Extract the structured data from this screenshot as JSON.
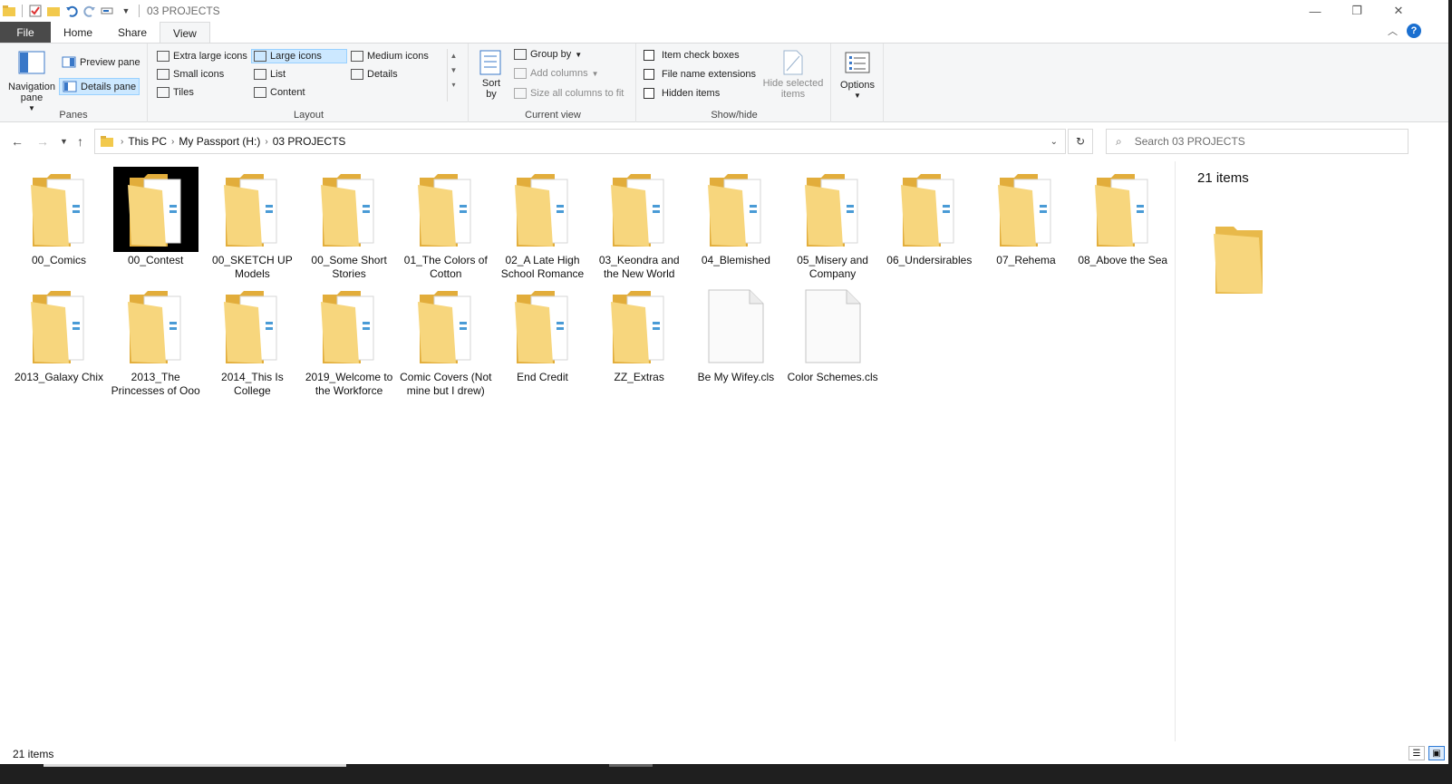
{
  "window": {
    "title": "03 PROJECTS"
  },
  "tabs": {
    "file": "File",
    "home": "Home",
    "share": "Share",
    "view": "View"
  },
  "ribbon": {
    "panes": {
      "navigation_pane": "Navigation pane",
      "preview_pane": "Preview pane",
      "details_pane": "Details pane",
      "group_label": "Panes"
    },
    "layout": {
      "extra_large_icons": "Extra large icons",
      "large_icons": "Large icons",
      "medium_icons": "Medium icons",
      "small_icons": "Small icons",
      "list": "List",
      "details": "Details",
      "tiles": "Tiles",
      "content": "Content",
      "group_label": "Layout"
    },
    "current_view": {
      "sort_by": "Sort by",
      "group_by": "Group by",
      "add_columns": "Add columns",
      "size_all_columns": "Size all columns to fit",
      "group_label": "Current view"
    },
    "show_hide": {
      "item_check_boxes": "Item check boxes",
      "file_name_extensions": "File name extensions",
      "hidden_items": "Hidden items",
      "hide_selected_items": "Hide selected items",
      "group_label": "Show/hide"
    },
    "options": "Options"
  },
  "address": {
    "crumbs": [
      "This PC",
      "My Passport (H:)",
      "03 PROJECTS"
    ],
    "search_placeholder": "Search 03 PROJECTS"
  },
  "items": [
    {
      "name": "00_Comics",
      "type": "folder"
    },
    {
      "name": "00_Contest",
      "type": "folder",
      "selected": true
    },
    {
      "name": "00_SKETCH UP Models",
      "type": "folder"
    },
    {
      "name": "00_Some Short Stories",
      "type": "folder"
    },
    {
      "name": "01_The Colors of Cotton",
      "type": "folder"
    },
    {
      "name": "02_A Late High School Romance",
      "type": "folder"
    },
    {
      "name": "03_Keondra and the New World",
      "type": "folder"
    },
    {
      "name": "04_Blemished",
      "type": "folder"
    },
    {
      "name": "05_Misery and Company",
      "type": "folder"
    },
    {
      "name": "06_Undersirables",
      "type": "folder"
    },
    {
      "name": "07_Rehema",
      "type": "folder"
    },
    {
      "name": "08_Above the Sea",
      "type": "folder"
    },
    {
      "name": "2013_Galaxy Chix",
      "type": "folder"
    },
    {
      "name": "2013_The Princesses of Ooo",
      "type": "folder"
    },
    {
      "name": "2014_This Is College",
      "type": "folder"
    },
    {
      "name": "2019_Welcome to the Workforce",
      "type": "folder"
    },
    {
      "name": "Comic Covers (Not mine but I drew)",
      "type": "folder"
    },
    {
      "name": "End Credit",
      "type": "folder"
    },
    {
      "name": "ZZ_Extras",
      "type": "folder"
    },
    {
      "name": "Be My Wifey.cls",
      "type": "file"
    },
    {
      "name": "Color Schemes.cls",
      "type": "file"
    }
  ],
  "details_pane": {
    "count": "21 items"
  },
  "status": {
    "count": "21 items"
  },
  "colors": {
    "accent": "#2b579a",
    "selection": "#cce8ff",
    "folder": "#f7d67d"
  }
}
